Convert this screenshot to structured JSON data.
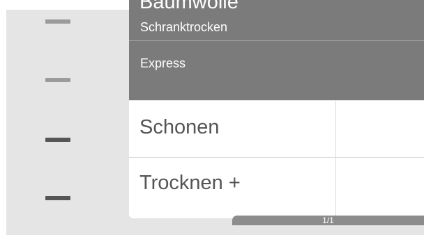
{
  "programs": [
    {
      "title": "Baumwolle",
      "subtitle": "Schranktrocken"
    },
    {
      "title": "Express"
    },
    {
      "title": "Schonen"
    },
    {
      "title": "Trocknen +"
    }
  ],
  "pager": {
    "text": "1/1"
  },
  "colors": {
    "selected_row": "#7b7b7b",
    "row": "#ffffff",
    "screen_background": "#e5e5e5",
    "marker_faded": "#9b9b9b",
    "marker_solid": "#555555",
    "pager_bar": "#8c8c8c"
  }
}
